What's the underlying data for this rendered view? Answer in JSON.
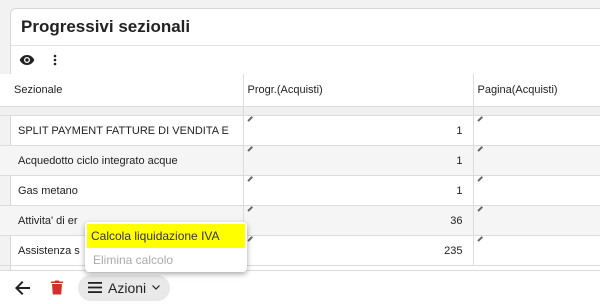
{
  "panel": {
    "title": "Progressivi sezionali"
  },
  "icons": {
    "eye": "eye-icon",
    "more": "more-vert-icon",
    "back": "arrow-left-icon",
    "delete": "trash-icon",
    "menu": "menu-icon",
    "chevron": "chevron-down-icon"
  },
  "table": {
    "headers": [
      "Sezionale",
      "Progr.(Acquisti)",
      "Pagina(Acquisti)"
    ],
    "rows": [
      {
        "sezionale": "SPLIT PAYMENT FATTURE DI VENDITA E",
        "progr": "1",
        "pagina": ""
      },
      {
        "sezionale": "Acquedotto ciclo integrato acque",
        "progr": "1",
        "pagina": ""
      },
      {
        "sezionale": "Gas metano",
        "progr": "1",
        "pagina": ""
      },
      {
        "sezionale": "Attivita' di er",
        "progr": "36",
        "pagina": ""
      },
      {
        "sezionale": "Assistenza s",
        "progr": "235",
        "pagina": ""
      }
    ]
  },
  "bottom_bar": {
    "actions_label": "Azioni"
  },
  "context_menu": {
    "items": [
      {
        "label": "Calcola liquidazione IVA",
        "state": "highlighted"
      },
      {
        "label": "Elimina calcolo",
        "state": "disabled"
      }
    ]
  },
  "colors": {
    "highlight": "#ffff00",
    "delete_icon": "#d32f2f",
    "disabled_text": "#aaaaaa"
  }
}
